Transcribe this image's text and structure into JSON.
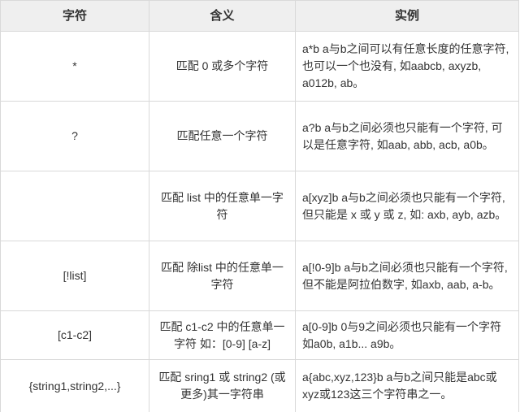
{
  "headers": {
    "char": "字符",
    "meaning": "含义",
    "example": "实例"
  },
  "rows": [
    {
      "char": "*",
      "meaning": "匹配 0 或多个字符",
      "example": "a*b  a与b之间可以有任意长度的任意字符, 也可以一个也没有, 如aabcb, axyzb, a012b, ab。"
    },
    {
      "char": "?",
      "meaning": "匹配任意一个字符",
      "example": "a?b  a与b之间必须也只能有一个字符, 可以是任意字符, 如aab, abb, acb, a0b。"
    },
    {
      "char": "",
      "meaning": "匹配 list 中的任意单一字符",
      "example": "a[xyz]b   a与b之间必须也只能有一个字符, 但只能是 x 或 y 或 z, 如: axb, ayb, azb。"
    },
    {
      "char": "[!list]",
      "meaning": "匹配 除list 中的任意单一字符",
      "example": "a[!0-9]b  a与b之间必须也只能有一个字符, 但不能是阿拉伯数字, 如axb, aab, a-b。"
    },
    {
      "char": "[c1-c2]",
      "meaning": "匹配 c1-c2 中的任意单一字符 如：[0-9] [a-z]",
      "example": "a[0-9]b  0与9之间必须也只能有一个字符 如a0b, a1b... a9b。"
    },
    {
      "char": "{string1,string2,...}",
      "meaning": "匹配 sring1 或 string2 (或更多)其一字符串",
      "example": "a{abc,xyz,123}b    a与b之间只能是abc或xyz或123这三个字符串之一。"
    }
  ]
}
